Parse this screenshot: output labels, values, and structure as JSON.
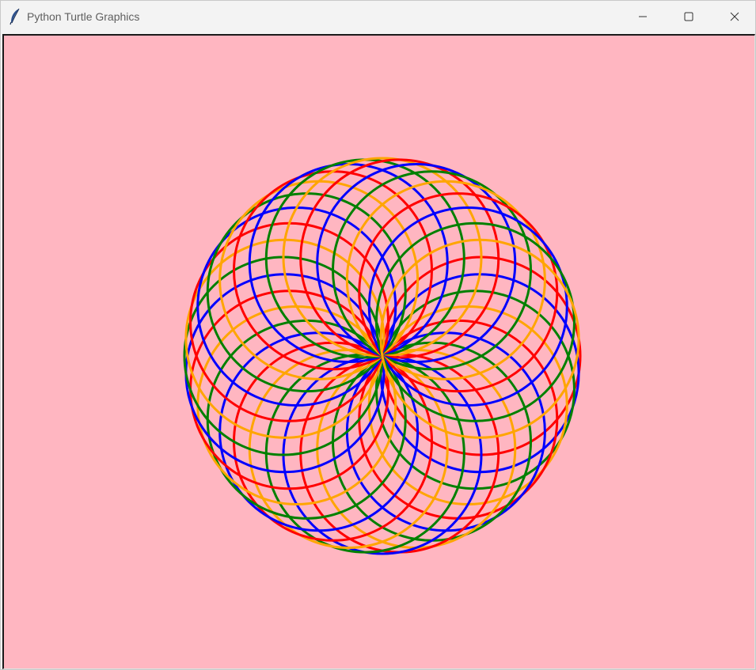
{
  "window": {
    "title": "Python Turtle Graphics",
    "app_icon": "feather-icon",
    "controls": {
      "minimize": "minimize-icon",
      "maximize": "maximize-icon",
      "close": "close-icon"
    }
  },
  "canvas": {
    "background_color": "#ffb6c1",
    "pen_colors": [
      "#ff0000",
      "#0000ff",
      "#008000",
      "#ffa500"
    ],
    "circle_count": 36,
    "pen_width": 3
  }
}
